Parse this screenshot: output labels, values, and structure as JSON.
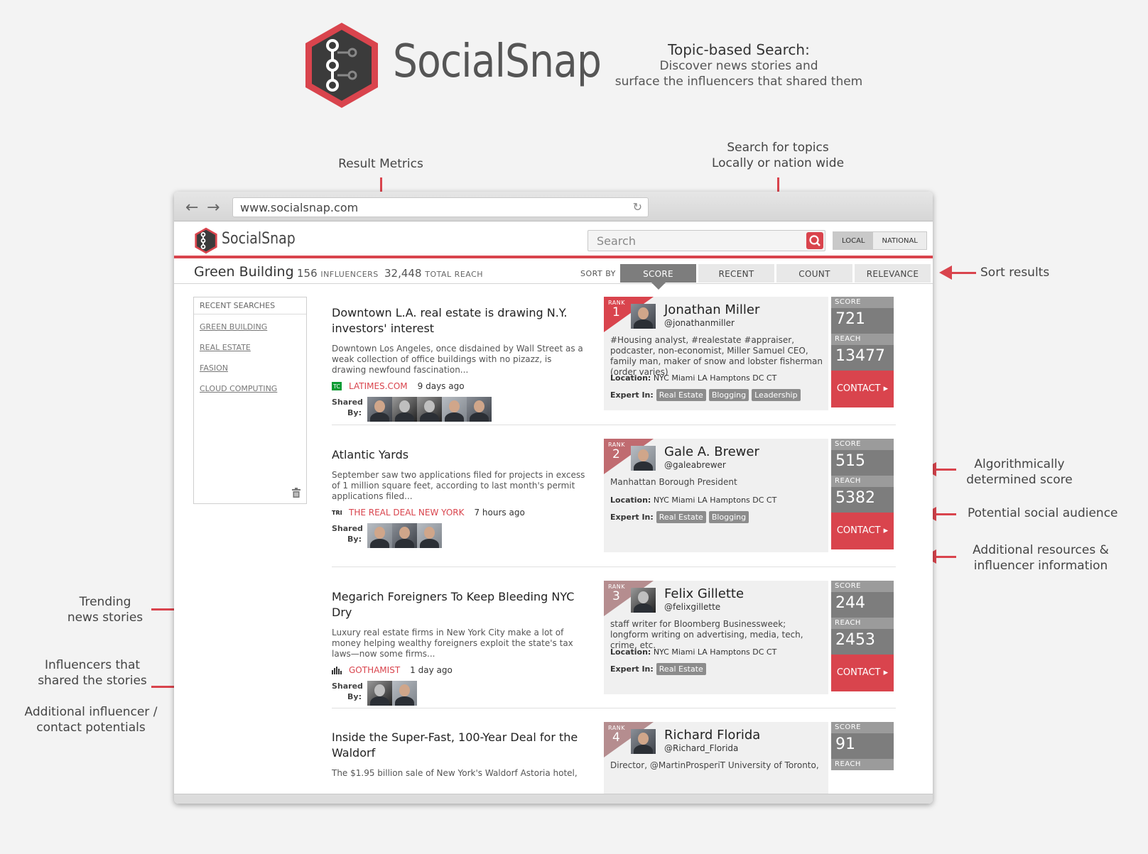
{
  "brand": {
    "name": "SocialSnap",
    "tagline_title": "Topic-based Search:",
    "tagline_line1": "Discover news stories and",
    "tagline_line2": "surface the influencers that shared them"
  },
  "annotations": {
    "result_metrics": "Result Metrics",
    "search_topics_1": "Search for topics",
    "search_topics_2": "Locally or nation wide",
    "sort_results": "Sort results",
    "score_1": "Algorithmically",
    "score_2": "determined score",
    "audience": "Potential social audience",
    "resources_1": "Additional resources &",
    "resources_2": "influencer information",
    "trending_1": "Trending",
    "trending_2": "news stories",
    "influencers_1": "Influencers that",
    "influencers_2": "shared the stories",
    "contact_1": "Additional influencer /",
    "contact_2": "contact potentials"
  },
  "browser": {
    "url": "www.socialsnap.com"
  },
  "app": {
    "name": "SocialSnap",
    "search_placeholder": "Search",
    "toggle_local": "LOCAL",
    "toggle_national": "NATIONAL"
  },
  "metrics": {
    "topic": "Green Building",
    "influencers_count": "156",
    "influencers_label": "INFLUENCERS",
    "reach_count": "32,448",
    "reach_label": "TOTAL REACH",
    "sort_by": "SORT BY",
    "sort_tabs": [
      "SCORE",
      "RECENT",
      "COUNT",
      "RELEVANCE"
    ]
  },
  "recent": {
    "header": "RECENT SEARCHES",
    "items": [
      "GREEN BUILDING",
      "REAL ESTATE",
      "FASION",
      "CLOUD COMPUTING"
    ]
  },
  "stories": [
    {
      "title": "Downtown L.A. real estate is drawing N.Y. investors' interest",
      "desc": "Downtown Los Angeles, once disdained by Wall Street as a weak collection of office buildings with no pizazz, is drawing newfound fascination...",
      "source": "LATIMES.COM",
      "time": "9 days ago",
      "shared_label": "Shared By:"
    },
    {
      "title": "Atlantic Yards",
      "desc": "September saw two applications filed for projects in excess of 1 million square feet, according to last month's permit applications filed...",
      "source": "THE REAL DEAL NEW YORK",
      "time": "7 hours ago",
      "shared_label": "Shared By:"
    },
    {
      "title": "Megarich Foreigners To Keep Bleeding NYC Dry",
      "desc": "Luxury real estate firms in New York City make a lot of money helping wealthy foreigners exploit the state's tax laws—now some firms...",
      "source": "GOTHAMIST",
      "time": "1 day ago",
      "shared_label": "Shared By:"
    },
    {
      "title": "Inside the Super-Fast, 100-Year Deal for the Waldorf",
      "desc": "The $1.95 billion sale of New York's Waldorf Astoria hotel,",
      "source": "",
      "time": "",
      "shared_label": ""
    }
  ],
  "influencers": [
    {
      "rank_label": "RANK",
      "rank": "1",
      "name": "Jonathan Miller",
      "handle": "@jonathanmiller",
      "bio": "#Housing analyst, #realestate #appraiser, podcaster, non-economist, Miller Samuel CEO, family man, maker of snow and lobster fisherman (order varies)",
      "location_label": "Location:",
      "location": "NYC Miami LA Hamptons DC CT",
      "expert_label": "Expert In:",
      "tags": [
        "Real Estate",
        "Blogging",
        "Leadership"
      ],
      "score_label": "SCORE",
      "score": "721",
      "reach_label": "REACH",
      "reach": "13477",
      "contact": "CONTACT ▸"
    },
    {
      "rank_label": "RANK",
      "rank": "2",
      "name": "Gale A. Brewer",
      "handle": "@galeabrewer",
      "bio": "Manhattan Borough President",
      "location_label": "Location:",
      "location": "NYC Miami LA Hamptons DC CT",
      "expert_label": "Expert In:",
      "tags": [
        "Real Estate",
        "Blogging"
      ],
      "score_label": "SCORE",
      "score": "515",
      "reach_label": "REACH",
      "reach": "5382",
      "contact": "CONTACT ▸"
    },
    {
      "rank_label": "RANK",
      "rank": "3",
      "name": "Felix Gillette",
      "handle": "@felixgillette",
      "bio": "staff writer for Bloomberg Businessweek; longform writing on advertising, media, tech, crime, etc.",
      "location_label": "Location:",
      "location": "NYC Miami LA Hamptons DC CT",
      "expert_label": "Expert In:",
      "tags": [
        "Real Estate"
      ],
      "score_label": "SCORE",
      "score": "244",
      "reach_label": "REACH",
      "reach": "2453",
      "contact": "CONTACT ▸"
    },
    {
      "rank_label": "RANK",
      "rank": "4",
      "name": "Richard Florida",
      "handle": "@Richard_Florida",
      "bio": "Director, @MartinProsperiT University of Toronto,",
      "score_label": "SCORE",
      "score": "91",
      "reach_label": "REACH"
    }
  ],
  "colors": {
    "accent": "#d9444d",
    "stat_bg": "#7d7d7d",
    "card_bg": "#f0f0f0"
  }
}
